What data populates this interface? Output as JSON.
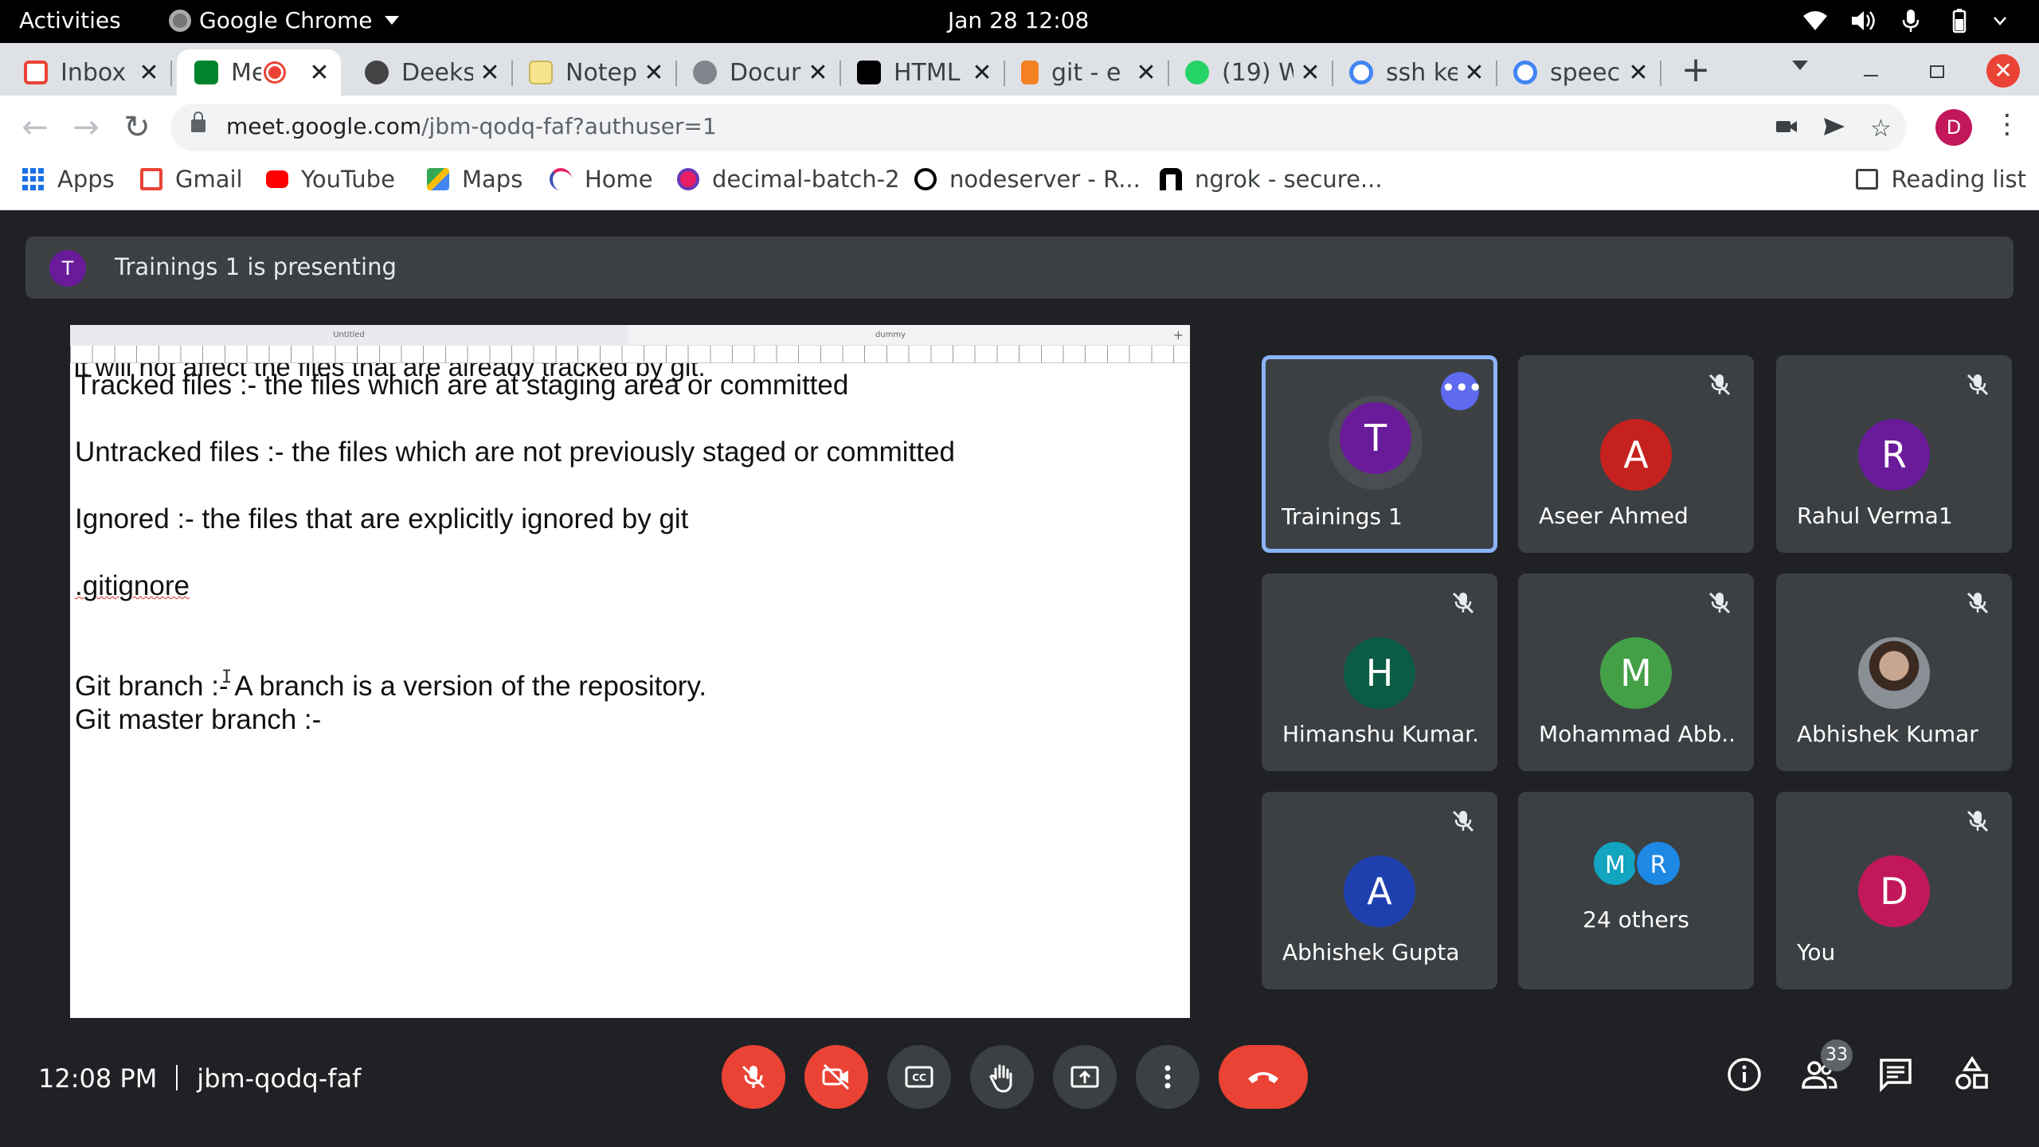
{
  "system": {
    "activities": "Activities",
    "app_name": "Google Chrome",
    "clock": "Jan 28  12:08"
  },
  "tabs": [
    {
      "title": "Inbox",
      "icon": "gmail-icon",
      "color": "#ea4335"
    },
    {
      "title": "Me",
      "icon": "meet-icon",
      "color": "#00832d",
      "active": true
    },
    {
      "title": "Deeks",
      "icon": "github-icon",
      "color": "#24292e"
    },
    {
      "title": "Notep",
      "icon": "notepad-icon",
      "color": "#f6e58d"
    },
    {
      "title": "Docur",
      "icon": "globe-icon",
      "color": "#80868b"
    },
    {
      "title": "HTML",
      "icon": "html-icon",
      "color": "#000000"
    },
    {
      "title": "git - e",
      "icon": "stackoverflow-icon",
      "color": "#f48024"
    },
    {
      "title": "(19) W",
      "icon": "whatsapp-icon",
      "color": "#25d366"
    },
    {
      "title": "ssh ke",
      "icon": "google-icon",
      "color": "#4285f4"
    },
    {
      "title": "speec",
      "icon": "google-icon",
      "color": "#4285f4"
    }
  ],
  "address_bar": {
    "host": "meet.google.com",
    "path": "/jbm-qodq-faf?authuser=1"
  },
  "profile_initial": "D",
  "bookmarks": [
    {
      "label": "Apps",
      "icon": "apps-grid-icon"
    },
    {
      "label": "Gmail",
      "icon": "gmail-icon"
    },
    {
      "label": "YouTube",
      "icon": "youtube-icon"
    },
    {
      "label": "Maps",
      "icon": "maps-icon"
    },
    {
      "label": "Home",
      "icon": "home-icon"
    },
    {
      "label": "decimal-batch-2",
      "icon": "decimal-icon"
    },
    {
      "label": "nodeserver - R...",
      "icon": "replit-icon"
    },
    {
      "label": "ngrok - secure...",
      "icon": "ngrok-icon"
    }
  ],
  "reading_list": "Reading list",
  "meet": {
    "presenter_initial": "T",
    "banner_text": "Trainings 1 is presenting",
    "presentation": {
      "tab1": "Untitled",
      "tab2": "dummy",
      "lines": [
        "It will not affect the files that are already tracked by git.",
        "Tracked files :- the files which are at staging area or committed",
        "Untracked files :- the files which are not previously staged or committed",
        "Ignored :- the files that are explicitly ignored by git",
        ".gitignore",
        "Git branch :- A branch is a version of the repository.",
        "Git master branch :-"
      ]
    },
    "participants": [
      {
        "name": "Trainings 1",
        "initial": "T",
        "color": "#6a1b9a",
        "speaking": true
      },
      {
        "name": "Aseer Ahmed",
        "initial": "A",
        "color": "#c5221f",
        "muted": true
      },
      {
        "name": "Rahul Verma1",
        "initial": "R",
        "color": "#6a1b9a",
        "muted": true
      },
      {
        "name": "Himanshu Kumar...",
        "initial": "H",
        "color": "#0b5c44",
        "muted": true
      },
      {
        "name": "Mohammad Abb...",
        "initial": "M",
        "color": "#43a047",
        "muted": true
      },
      {
        "name": "Abhishek Kumar",
        "initial": "",
        "photo": true,
        "muted": true
      },
      {
        "name": "Abhishek Gupta",
        "initial": "A",
        "color": "#1e40af",
        "muted": true
      },
      {
        "name": "You",
        "initial": "D",
        "color": "#c2185b",
        "muted": true
      }
    ],
    "others": {
      "label": "24 others",
      "avatars": [
        {
          "initial": "M",
          "color": "#12a4c0"
        },
        {
          "initial": "R",
          "color": "#1e88e5"
        }
      ]
    },
    "meeting_time": "12:08 PM",
    "meeting_code": "jbm-qodq-faf",
    "participant_count": "33"
  }
}
